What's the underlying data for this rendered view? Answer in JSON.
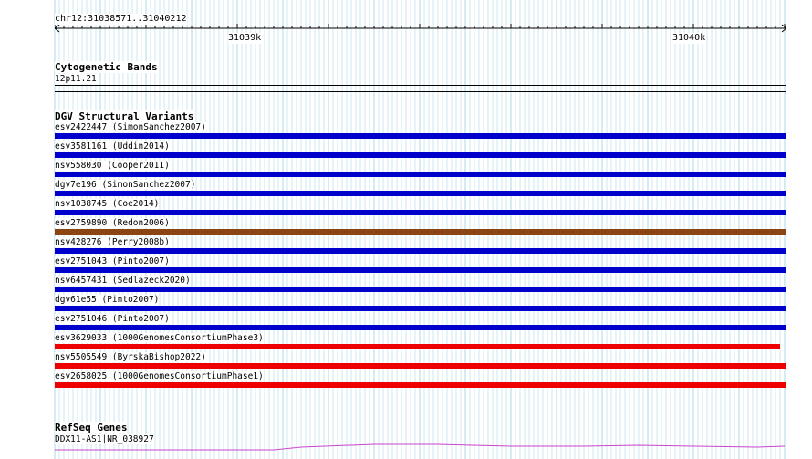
{
  "ruler": {
    "region": "chr12:31038571..31040212",
    "ticks": [
      "31039k",
      "31040k"
    ]
  },
  "cytoband": {
    "title": "Cytogenetic Bands",
    "band": "12p11.21"
  },
  "dgv": {
    "title": "DGV Structural Variants",
    "items": [
      {
        "label": "esv2422447 (SimonSanchez2007)",
        "color": "#0000cc"
      },
      {
        "label": "esv3581161 (Uddin2014)",
        "color": "#0000cc"
      },
      {
        "label": "nsv558030 (Cooper2011)",
        "color": "#0000cc"
      },
      {
        "label": "dgv7e196 (SimonSanchez2007)",
        "color": "#0000cc"
      },
      {
        "label": "nsv1038745 (Coe2014)",
        "color": "#0000cc"
      },
      {
        "label": "esv2759890 (Redon2006)",
        "color": "#8b4513"
      },
      {
        "label": "nsv428276 (Perry2008b)",
        "color": "#0000cc"
      },
      {
        "label": "esv2751043 (Pinto2007)",
        "color": "#0000cc"
      },
      {
        "label": "nsv6457431 (Sedlazeck2020)",
        "color": "#0000cc"
      },
      {
        "label": "dgv61e55 (Pinto2007)",
        "color": "#0000cc"
      },
      {
        "label": "esv2751046 (Pinto2007)",
        "color": "#0000cc"
      },
      {
        "label": "esv3629033 (1000GenomesConsortiumPhase3)",
        "color": "#ee0000"
      },
      {
        "label": "nsv5505549 (ByrskaBishop2022)",
        "color": "#ee0000"
      },
      {
        "label": "esv2658025 (1000GenomesConsortiumPhase1)",
        "color": "#ee0000"
      }
    ]
  },
  "refseq": {
    "title": "RefSeq Genes",
    "gene": "DDX11-AS1|NR_038927",
    "color": "#cc44cc"
  },
  "colors": {
    "grid": "#add8e6",
    "variant_gain": "#0000cc",
    "variant_loss": "#ee0000",
    "variant_both": "#8b4513"
  }
}
